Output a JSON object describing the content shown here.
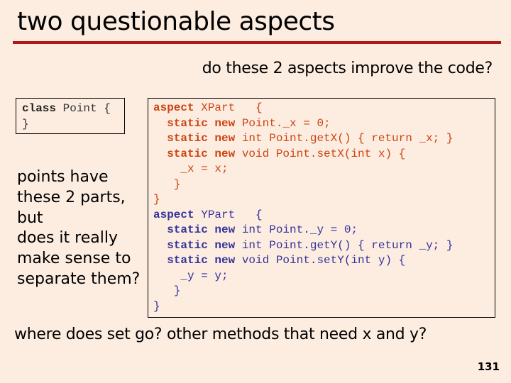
{
  "slide": {
    "title": "two questionable aspects",
    "subtitle": "do these 2 aspects improve the code?",
    "class_code": {
      "line1_kw": "class",
      "line1_rest": " Point {",
      "line2": "}"
    },
    "side_text": [
      "points have",
      "these 2 parts,",
      "but",
      "does it really",
      "make sense to",
      "separate them?"
    ],
    "aspect_x": {
      "header_kw": "aspect",
      "header_rest": " XPart   {",
      "lines": [
        {
          "indent": "  ",
          "kw": "static new",
          "rest": " Point._x = 0;"
        },
        {
          "indent": "  ",
          "kw": "static new",
          "rest": " int Point.getX() { return _x; }"
        },
        {
          "indent": "  ",
          "kw": "static new",
          "rest": " void Point.setX(int x) {"
        }
      ],
      "body": "    _x = x;",
      "close_inner": "   }",
      "close_outer": "}"
    },
    "aspect_y": {
      "header_kw": "aspect",
      "header_rest": " YPart   {",
      "lines": [
        {
          "indent": "  ",
          "kw": "static new",
          "rest": " int Point._y = 0;"
        },
        {
          "indent": "  ",
          "kw": "static new",
          "rest": " int Point.getY() { return _y; }"
        },
        {
          "indent": "  ",
          "kw": "static new",
          "rest": " void Point.setY(int y) {"
        }
      ],
      "body": "    _y = y;",
      "close_inner": "   }",
      "close_outer": "}"
    },
    "bottom_text": "where does set go? other methods that need x and y?",
    "page_number": "131",
    "colors": {
      "background": "#fdede1",
      "rule": "#b01818",
      "aspect_x_keyword": "#cc4411",
      "aspect_y_keyword": "#333399"
    }
  }
}
